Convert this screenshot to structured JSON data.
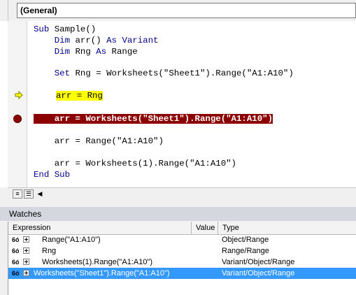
{
  "combo": {
    "selected": "(General)"
  },
  "code": {
    "lines": [
      {
        "kw": "Sub",
        "rest": " Sample()"
      },
      {
        "indent": "    ",
        "kw": "Dim",
        "rest": " arr() ",
        "kw2": "As",
        "rest2": " ",
        "kw3": "Variant"
      },
      {
        "indent": "    ",
        "kw": "Dim",
        "rest": " Rng ",
        "kw2": "As",
        "rest2": " Range"
      },
      {
        "indent": "    ",
        "kw": "Set",
        "rest": " Rng = Worksheets(\"Sheet1\").Range(\"A1:A10\")"
      },
      {
        "text": "arr = Rng"
      },
      {
        "text": "arr = Worksheets(\"Sheet1\").Range(\"A1:A10\")"
      },
      {
        "indent": "    ",
        "text": "arr = Range(\"A1:A10\")"
      },
      {
        "indent": "    ",
        "text": "arr = Worksheets(1).Range(\"A1:A10\")"
      },
      {
        "kw": "End",
        "rest": " ",
        "kw2": "Sub"
      }
    ]
  },
  "watches": {
    "title": "Watches",
    "columns": [
      "Expression",
      "Value",
      "Type"
    ],
    "rows": [
      {
        "expression": "Range(\"A1:A10\")",
        "value": "",
        "type": "Object/Range"
      },
      {
        "expression": "Rng",
        "value": "",
        "type": "Range/Range"
      },
      {
        "expression": "Worksheets(1).Range(\"A1:A10\")",
        "value": "",
        "type": "Variant/Object/Range"
      },
      {
        "expression": "Worksheets(\"Sheet1\").Range(\"A1:A10\")",
        "value": "",
        "type": "Variant/Object/Range"
      }
    ]
  },
  "colors": {
    "breakpoint": "#8b0000",
    "current_line": "#ffff00",
    "selection": "#3399ff",
    "keyword": "#00008b"
  },
  "icons": [
    "execution-arrow-icon",
    "breakpoint-icon",
    "glasses-icon",
    "expand-icon",
    "procedure-view-icon",
    "full-module-view-icon",
    "scroll-left-icon"
  ]
}
